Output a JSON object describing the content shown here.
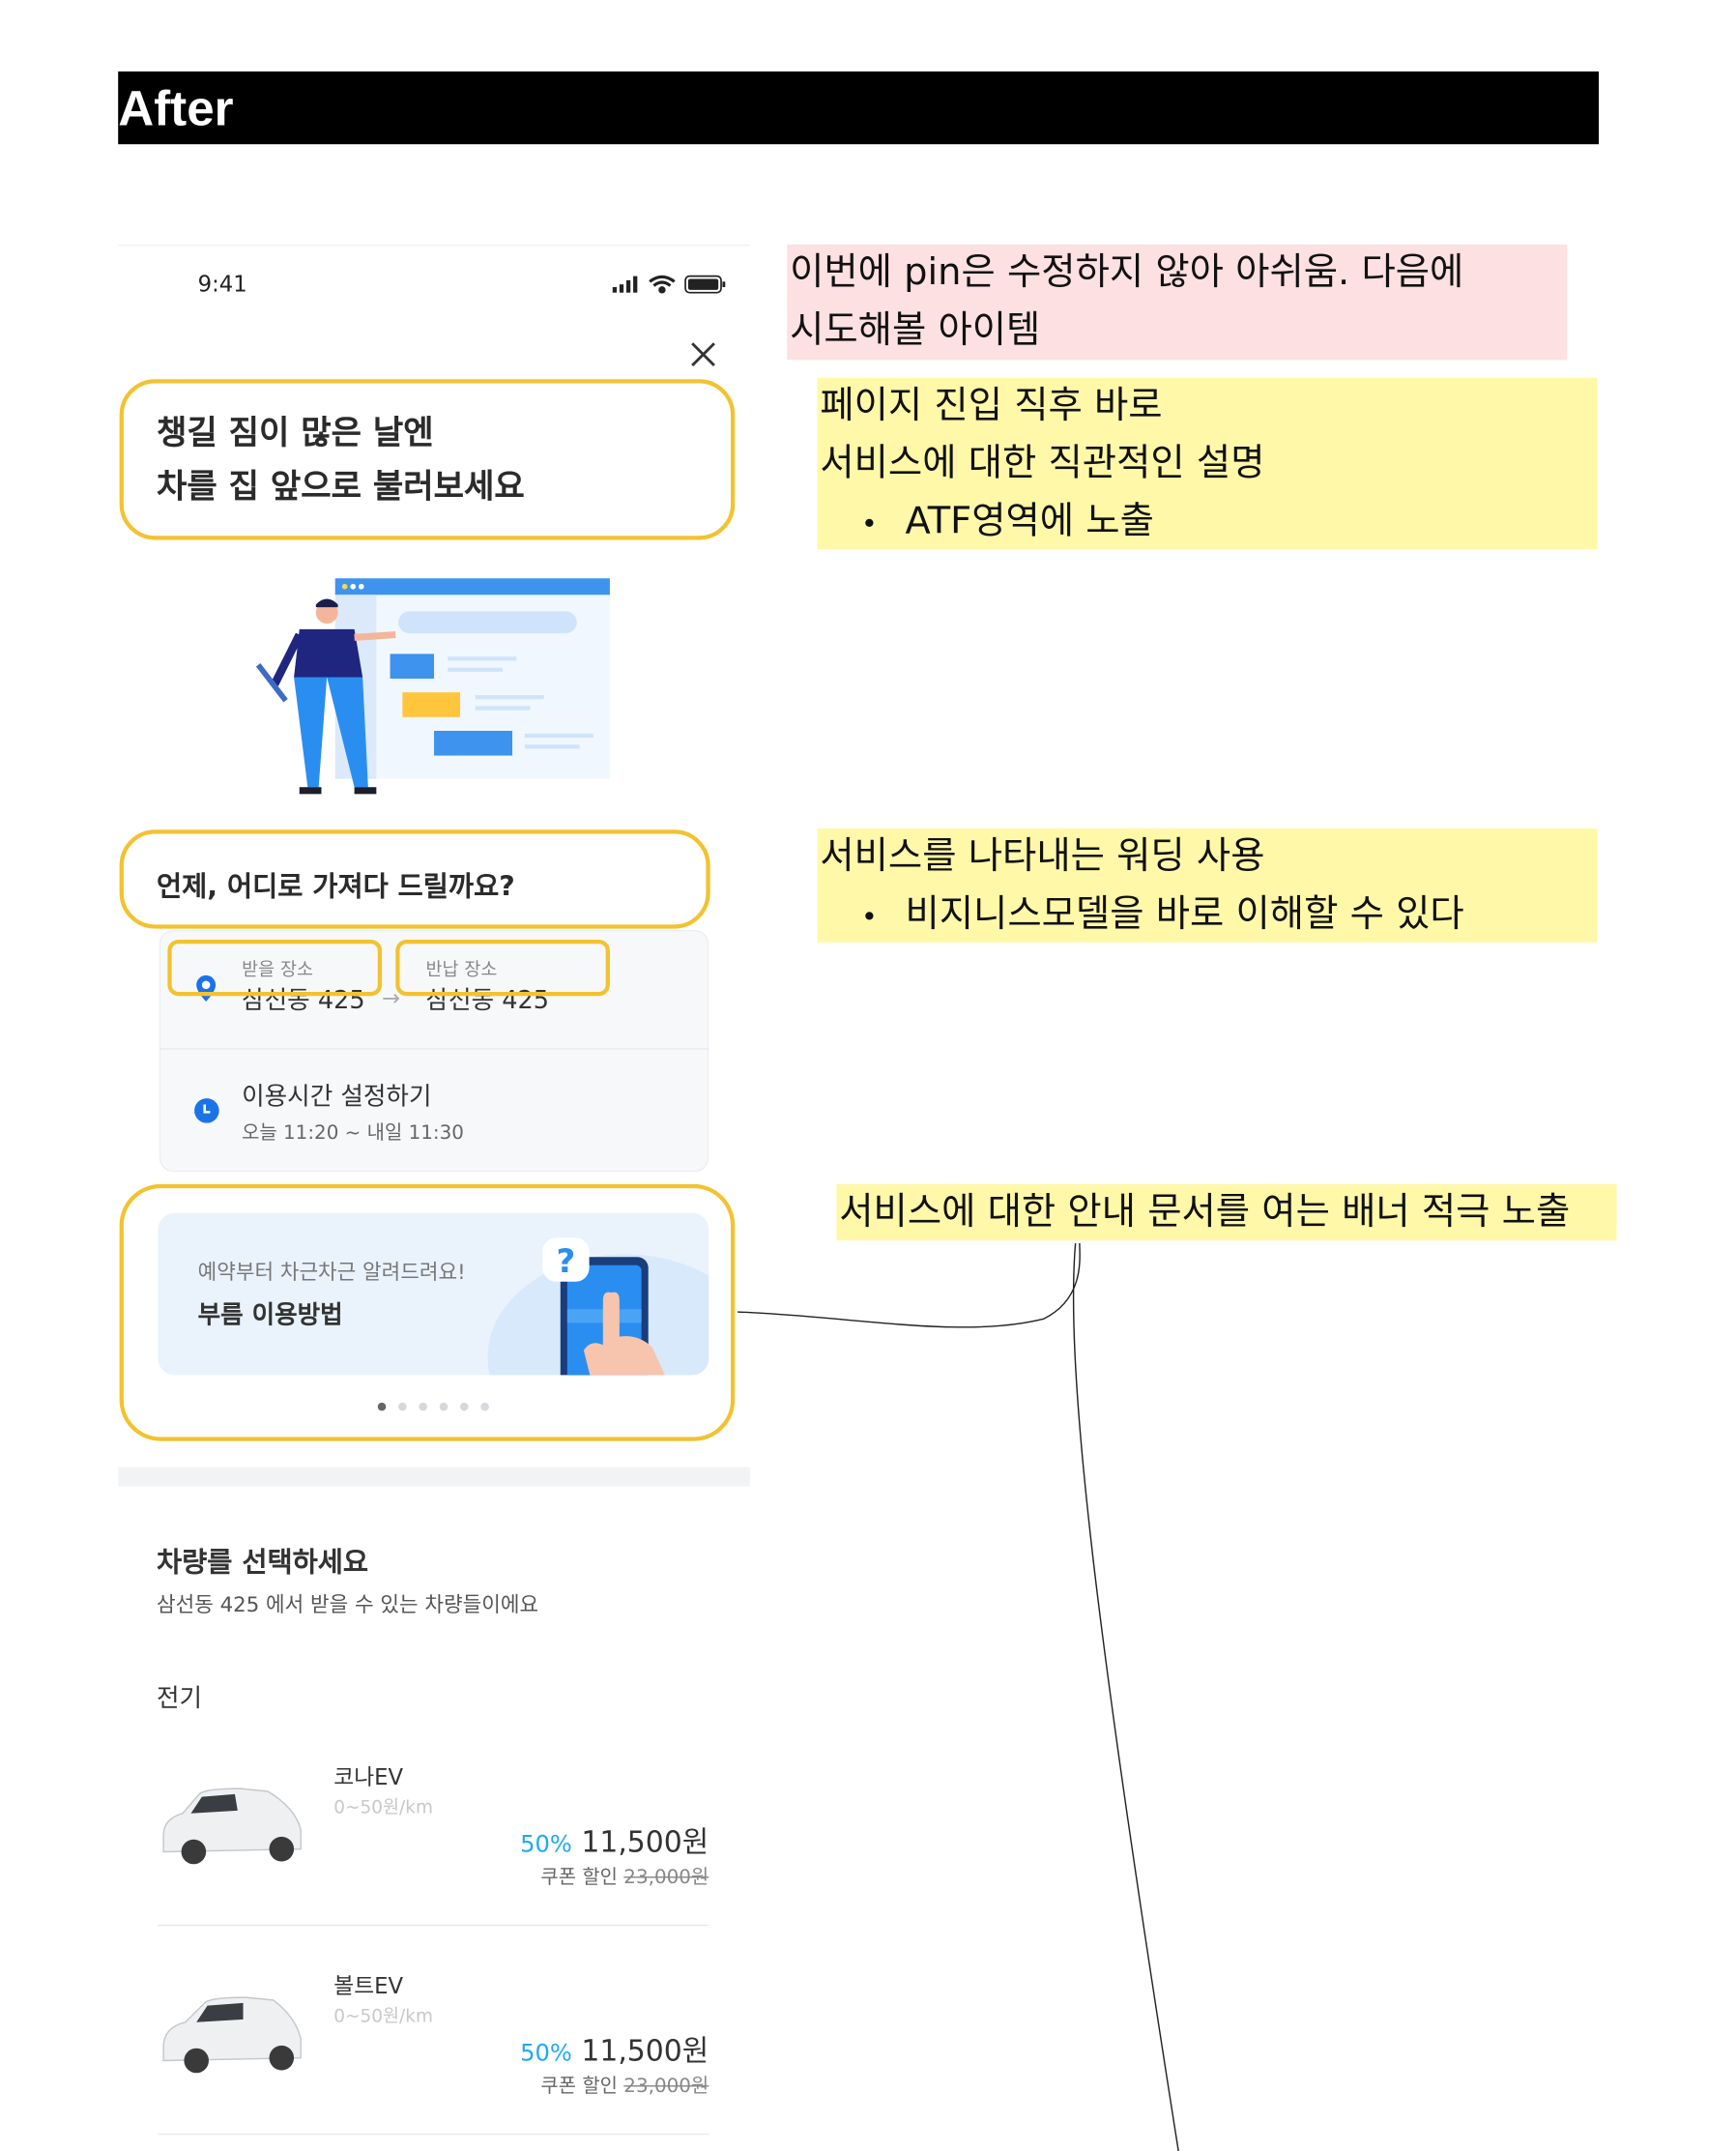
{
  "header": {
    "title": "After"
  },
  "status_bar": {
    "time": "9:41"
  },
  "hero": {
    "line1": "챙길 짐이 많은 날엔",
    "line2": "차를 집 앞으로 불러보세요"
  },
  "question": "언제, 어디로 가져다 드릴까요?",
  "location": {
    "pickup_label": "받을 장소",
    "pickup_value": "삼선동 425",
    "return_label": "반납 장소",
    "return_value": "삼선동 425"
  },
  "time": {
    "title": "이용시간 설정하기",
    "range": "오늘 11:20 ~ 내일 11:30"
  },
  "banner": {
    "subtitle": "예약부터 차근차근 알려드려요!",
    "title": "부름 이용방법",
    "page_count": 6,
    "current_page": 1
  },
  "vehicles": {
    "title": "차량를 선택하세요",
    "subtitle": "삼선동 425 에서 받을 수 있는 차량들이에요",
    "category": "전기",
    "items": [
      {
        "name": "코나EV",
        "rate": "0~50원/km",
        "discount": "50%",
        "price": "11,500원",
        "coupon_label": "쿠폰 할인",
        "original_price": "23,000원"
      },
      {
        "name": "볼트EV",
        "rate": "0~50원/km",
        "discount": "50%",
        "price": "11,500원",
        "coupon_label": "쿠폰 할인",
        "original_price": "23,000원"
      }
    ]
  },
  "annotations": {
    "pin": {
      "line1": "이번에 pin은 수정하지 않아 아쉬움. 다음에",
      "line2": "시도해볼 아이템"
    },
    "atf": {
      "line1": "페이지 진입 직후 바로",
      "line2": "서비스에 대한 직관적인 설명",
      "bullet": "ATF영역에 노출"
    },
    "wording": {
      "line1": "서비스를 나타내는 워딩 사용",
      "bullet": "비지니스모델을 바로 이해할 수 있다"
    },
    "banner": {
      "line1": "서비스에 대한 안내 문서를 여는 배너 적극 노출"
    }
  },
  "colors": {
    "highlight_border": "#f2c230",
    "note_yellow": "#fff8a8",
    "note_pink": "#fde0e1",
    "accent_blue": "#1eaaf1",
    "icon_blue": "#1a73e8"
  }
}
